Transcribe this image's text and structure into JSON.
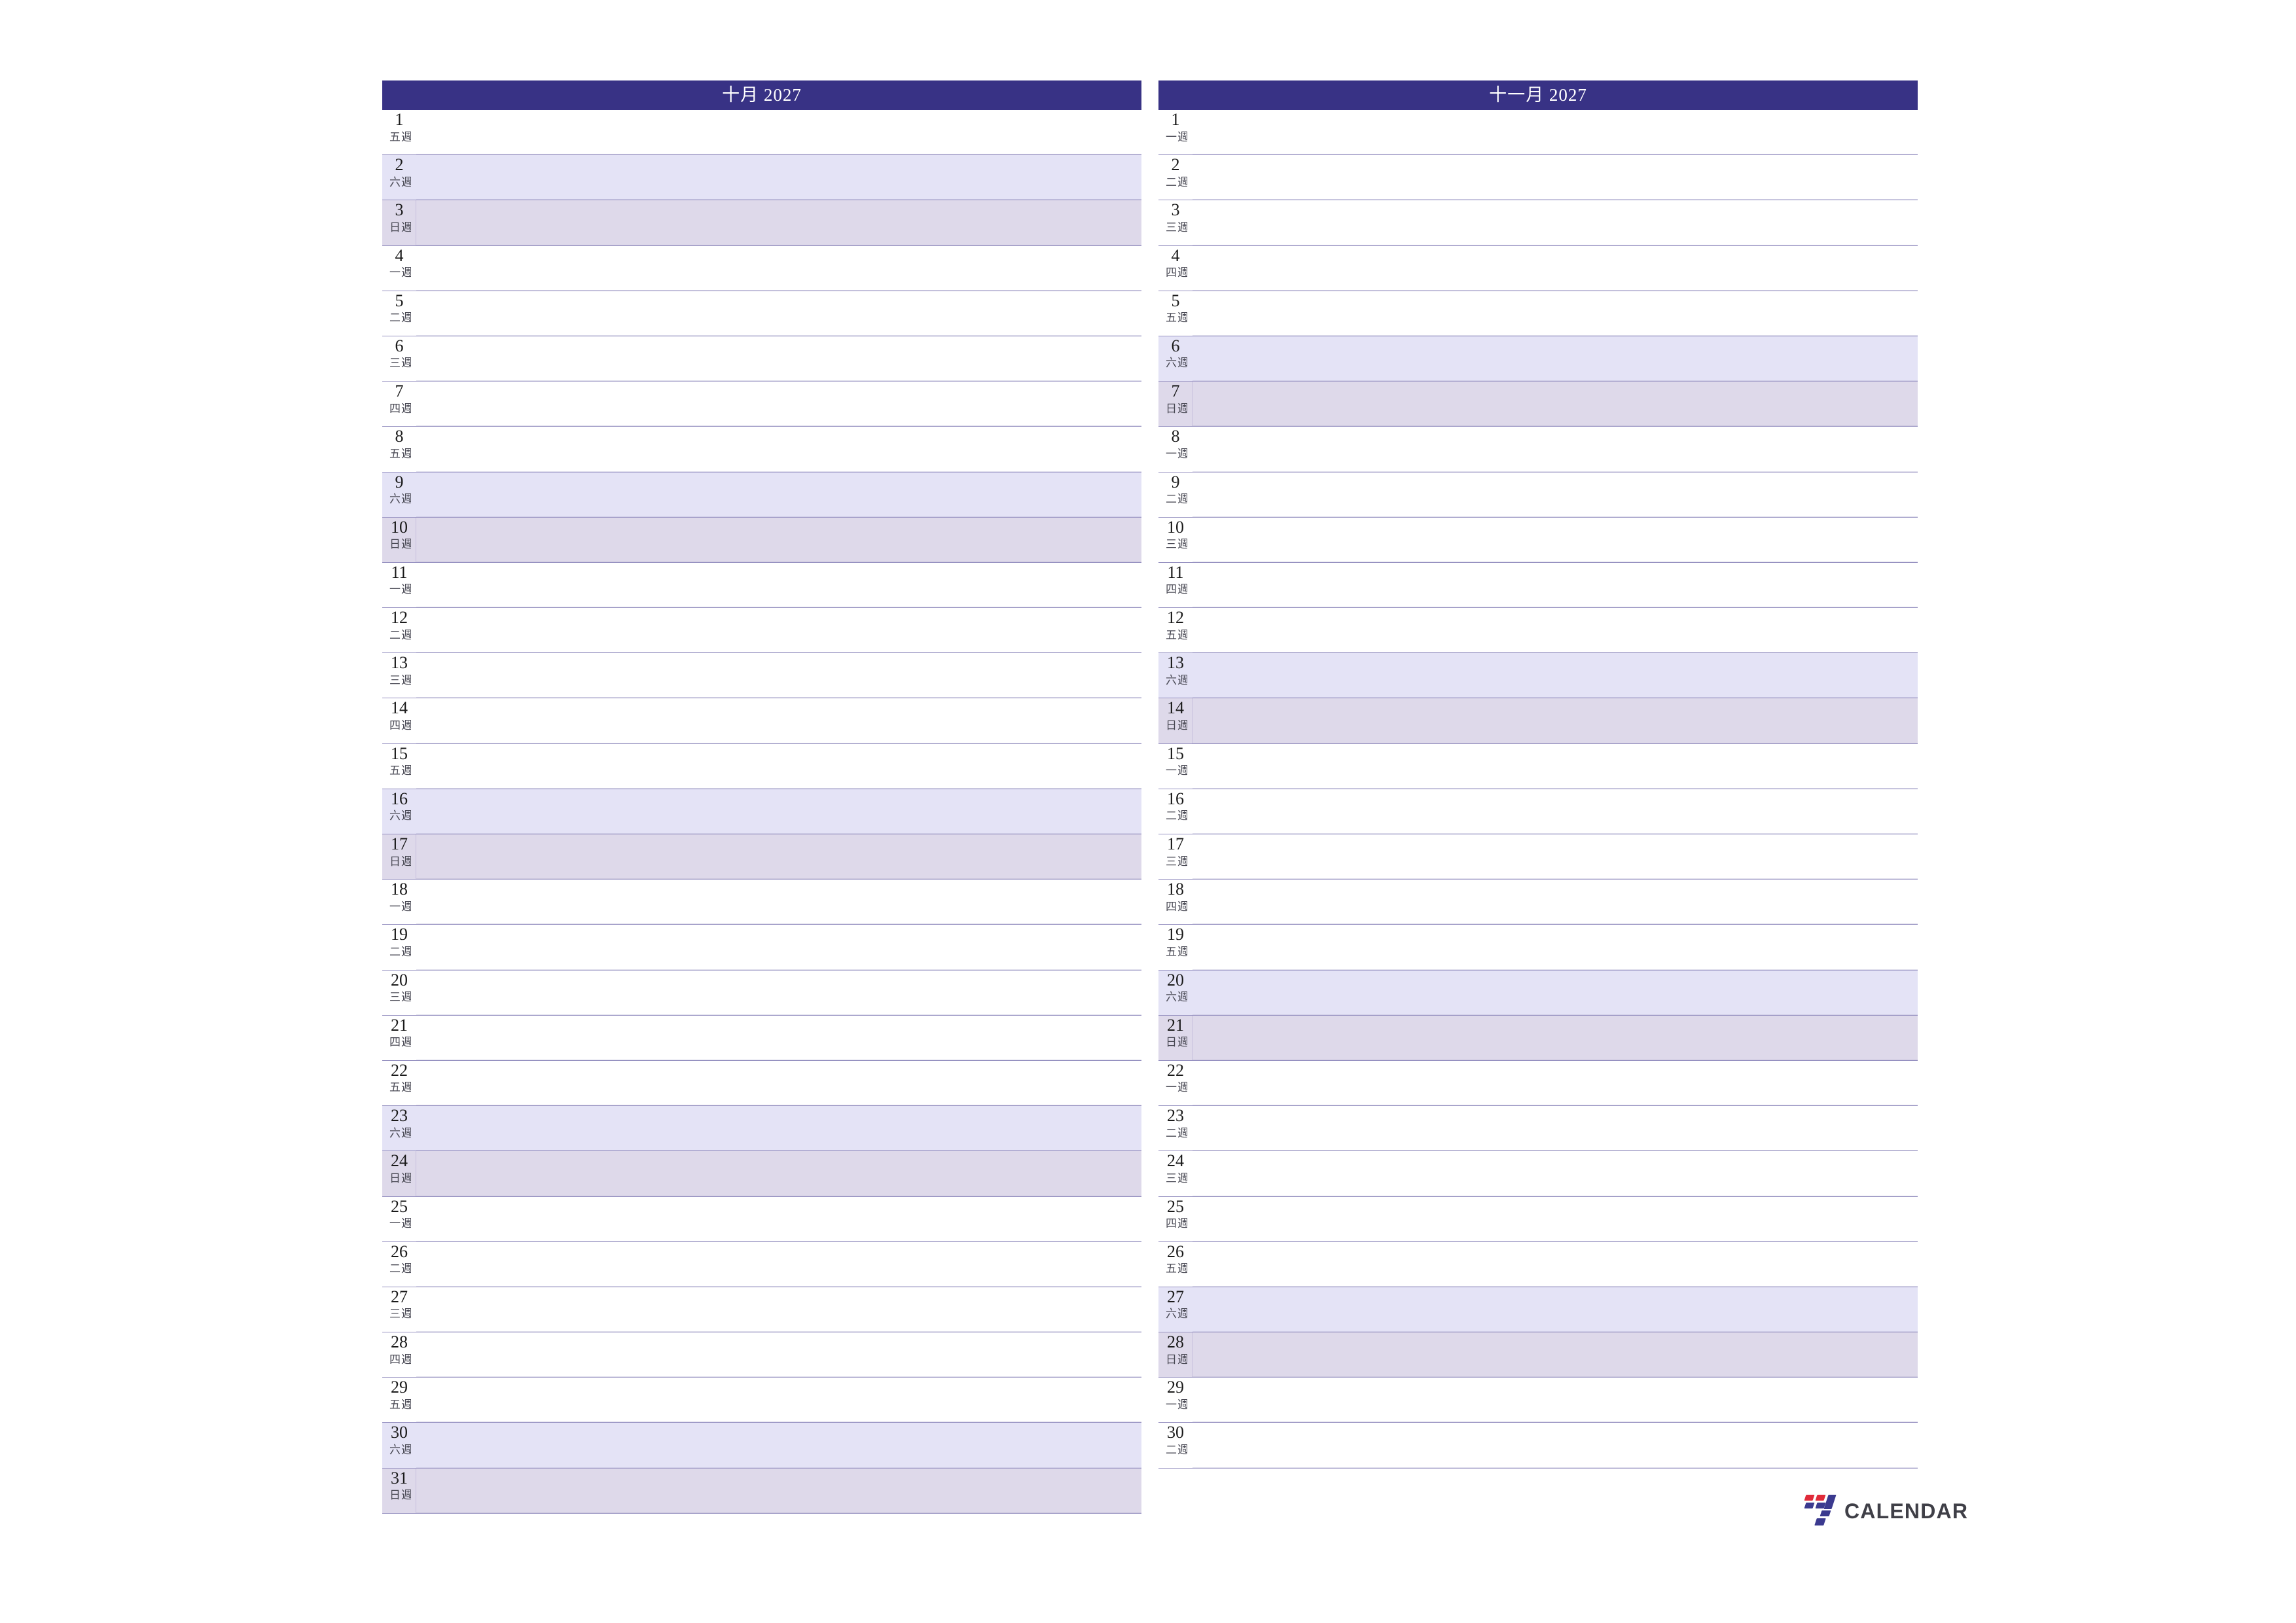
{
  "document": {
    "type": "monthly-planner",
    "locale": "zh-Hant",
    "year": "2027",
    "page_background": "#ffffff"
  },
  "colors": {
    "header_bar": "#383285",
    "header_text": "#ffffff",
    "row_divider": "#9590c0",
    "saturday_fill": "#e4e3f6",
    "sunday_fill": "#ded9ea",
    "day_number": "#1a1a1a",
    "day_name": "#4a4a55",
    "logo_red": "#e02b3a",
    "logo_blue": "#3b3a8f",
    "wordmark": "#3f3f47"
  },
  "panels": [
    {
      "id": "october",
      "header": "十月  2027",
      "month_name": "十月",
      "year": "2027",
      "days": [
        {
          "num": "1",
          "name": "週五",
          "weekday": "fri"
        },
        {
          "num": "2",
          "name": "週六",
          "weekday": "sat"
        },
        {
          "num": "3",
          "name": "週日",
          "weekday": "sun"
        },
        {
          "num": "4",
          "name": "週一",
          "weekday": "mon"
        },
        {
          "num": "5",
          "name": "週二",
          "weekday": "tue"
        },
        {
          "num": "6",
          "name": "週三",
          "weekday": "wed"
        },
        {
          "num": "7",
          "name": "週四",
          "weekday": "thu"
        },
        {
          "num": "8",
          "name": "週五",
          "weekday": "fri"
        },
        {
          "num": "9",
          "name": "週六",
          "weekday": "sat"
        },
        {
          "num": "10",
          "name": "週日",
          "weekday": "sun"
        },
        {
          "num": "11",
          "name": "週一",
          "weekday": "mon"
        },
        {
          "num": "12",
          "name": "週二",
          "weekday": "tue"
        },
        {
          "num": "13",
          "name": "週三",
          "weekday": "wed"
        },
        {
          "num": "14",
          "name": "週四",
          "weekday": "thu"
        },
        {
          "num": "15",
          "name": "週五",
          "weekday": "fri"
        },
        {
          "num": "16",
          "name": "週六",
          "weekday": "sat"
        },
        {
          "num": "17",
          "name": "週日",
          "weekday": "sun"
        },
        {
          "num": "18",
          "name": "週一",
          "weekday": "mon"
        },
        {
          "num": "19",
          "name": "週二",
          "weekday": "tue"
        },
        {
          "num": "20",
          "name": "週三",
          "weekday": "wed"
        },
        {
          "num": "21",
          "name": "週四",
          "weekday": "thu"
        },
        {
          "num": "22",
          "name": "週五",
          "weekday": "fri"
        },
        {
          "num": "23",
          "name": "週六",
          "weekday": "sat"
        },
        {
          "num": "24",
          "name": "週日",
          "weekday": "sun"
        },
        {
          "num": "25",
          "name": "週一",
          "weekday": "mon"
        },
        {
          "num": "26",
          "name": "週二",
          "weekday": "tue"
        },
        {
          "num": "27",
          "name": "週三",
          "weekday": "wed"
        },
        {
          "num": "28",
          "name": "週四",
          "weekday": "thu"
        },
        {
          "num": "29",
          "name": "週五",
          "weekday": "fri"
        },
        {
          "num": "30",
          "name": "週六",
          "weekday": "sat"
        },
        {
          "num": "31",
          "name": "週日",
          "weekday": "sun"
        }
      ]
    },
    {
      "id": "november",
      "header": "十一月  2027",
      "month_name": "十一月",
      "year": "2027",
      "days": [
        {
          "num": "1",
          "name": "週一",
          "weekday": "mon"
        },
        {
          "num": "2",
          "name": "週二",
          "weekday": "tue"
        },
        {
          "num": "3",
          "name": "週三",
          "weekday": "wed"
        },
        {
          "num": "4",
          "name": "週四",
          "weekday": "thu"
        },
        {
          "num": "5",
          "name": "週五",
          "weekday": "fri"
        },
        {
          "num": "6",
          "name": "週六",
          "weekday": "sat"
        },
        {
          "num": "7",
          "name": "週日",
          "weekday": "sun"
        },
        {
          "num": "8",
          "name": "週一",
          "weekday": "mon"
        },
        {
          "num": "9",
          "name": "週二",
          "weekday": "tue"
        },
        {
          "num": "10",
          "name": "週三",
          "weekday": "wed"
        },
        {
          "num": "11",
          "name": "週四",
          "weekday": "thu"
        },
        {
          "num": "12",
          "name": "週五",
          "weekday": "fri"
        },
        {
          "num": "13",
          "name": "週六",
          "weekday": "sat"
        },
        {
          "num": "14",
          "name": "週日",
          "weekday": "sun"
        },
        {
          "num": "15",
          "name": "週一",
          "weekday": "mon"
        },
        {
          "num": "16",
          "name": "週二",
          "weekday": "tue"
        },
        {
          "num": "17",
          "name": "週三",
          "weekday": "wed"
        },
        {
          "num": "18",
          "name": "週四",
          "weekday": "thu"
        },
        {
          "num": "19",
          "name": "週五",
          "weekday": "fri"
        },
        {
          "num": "20",
          "name": "週六",
          "weekday": "sat"
        },
        {
          "num": "21",
          "name": "週日",
          "weekday": "sun"
        },
        {
          "num": "22",
          "name": "週一",
          "weekday": "mon"
        },
        {
          "num": "23",
          "name": "週二",
          "weekday": "tue"
        },
        {
          "num": "24",
          "name": "週三",
          "weekday": "wed"
        },
        {
          "num": "25",
          "name": "週四",
          "weekday": "thu"
        },
        {
          "num": "26",
          "name": "週五",
          "weekday": "fri"
        },
        {
          "num": "27",
          "name": "週六",
          "weekday": "sat"
        },
        {
          "num": "28",
          "name": "週日",
          "weekday": "sun"
        },
        {
          "num": "29",
          "name": "週一",
          "weekday": "mon"
        },
        {
          "num": "30",
          "name": "週二",
          "weekday": "tue"
        }
      ]
    }
  ],
  "footer": {
    "logo_mark": "seven-logo-icon",
    "wordmark": "CALENDAR"
  }
}
